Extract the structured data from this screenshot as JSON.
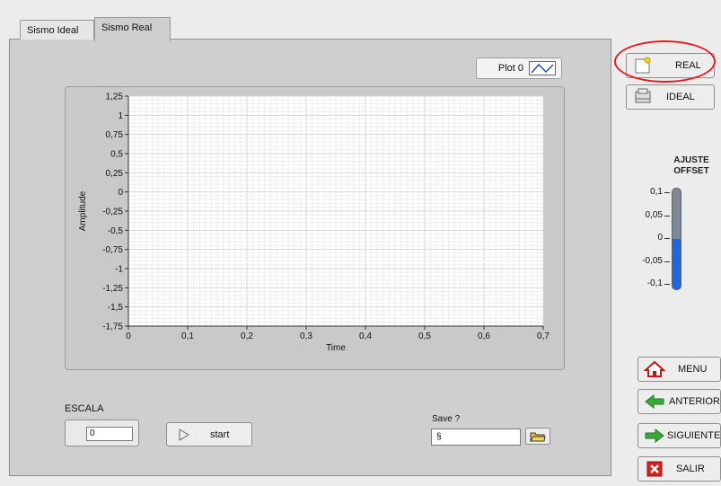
{
  "tabs": [
    {
      "label": "Sismo Ideal",
      "active": false
    },
    {
      "label": "Sismo Real",
      "active": true
    }
  ],
  "legend": {
    "label": "Plot 0"
  },
  "chart_data": {
    "type": "line",
    "xlabel": "Time",
    "ylabel": "Amplitude",
    "xlim": [
      0,
      0.7
    ],
    "ylim": [
      -1.75,
      1.25
    ],
    "x_ticks": [
      "0",
      "0,1",
      "0,2",
      "0,3",
      "0,4",
      "0,5",
      "0,6",
      "0,7"
    ],
    "y_ticks": [
      "1,25",
      "1",
      "0,75",
      "0,5",
      "0,25",
      "0",
      "-0,25",
      "-0,5",
      "-0,75",
      "-1",
      "-1,25",
      "-1,5",
      "-1,75"
    ],
    "grid": true,
    "series": [
      {
        "name": "Plot 0",
        "values": []
      }
    ]
  },
  "escala": {
    "label": "ESCALA",
    "value": "0"
  },
  "start_button": {
    "label": "start"
  },
  "save": {
    "label": "Save ?",
    "value": "",
    "path_glyph": "§"
  },
  "mode_buttons": {
    "real": "REAL",
    "ideal": "IDEAL"
  },
  "offset_slider": {
    "title_line1": "AJUSTE",
    "title_line2": "OFFSET",
    "ticks": [
      "0,1",
      "0,05",
      "0",
      "-0,05",
      "-0,1"
    ],
    "value": 0,
    "min": -0.1,
    "max": 0.1
  },
  "nav_buttons": {
    "menu": "MENU",
    "anterior": "ANTERIOR",
    "siguiente": "SIGUIENTE",
    "salir": "SALIR"
  },
  "colors": {
    "slider_fill": "#2266dd",
    "highlight": "#e02020",
    "arrow_green": "#3aa83a",
    "exit_red": "#d42020"
  }
}
